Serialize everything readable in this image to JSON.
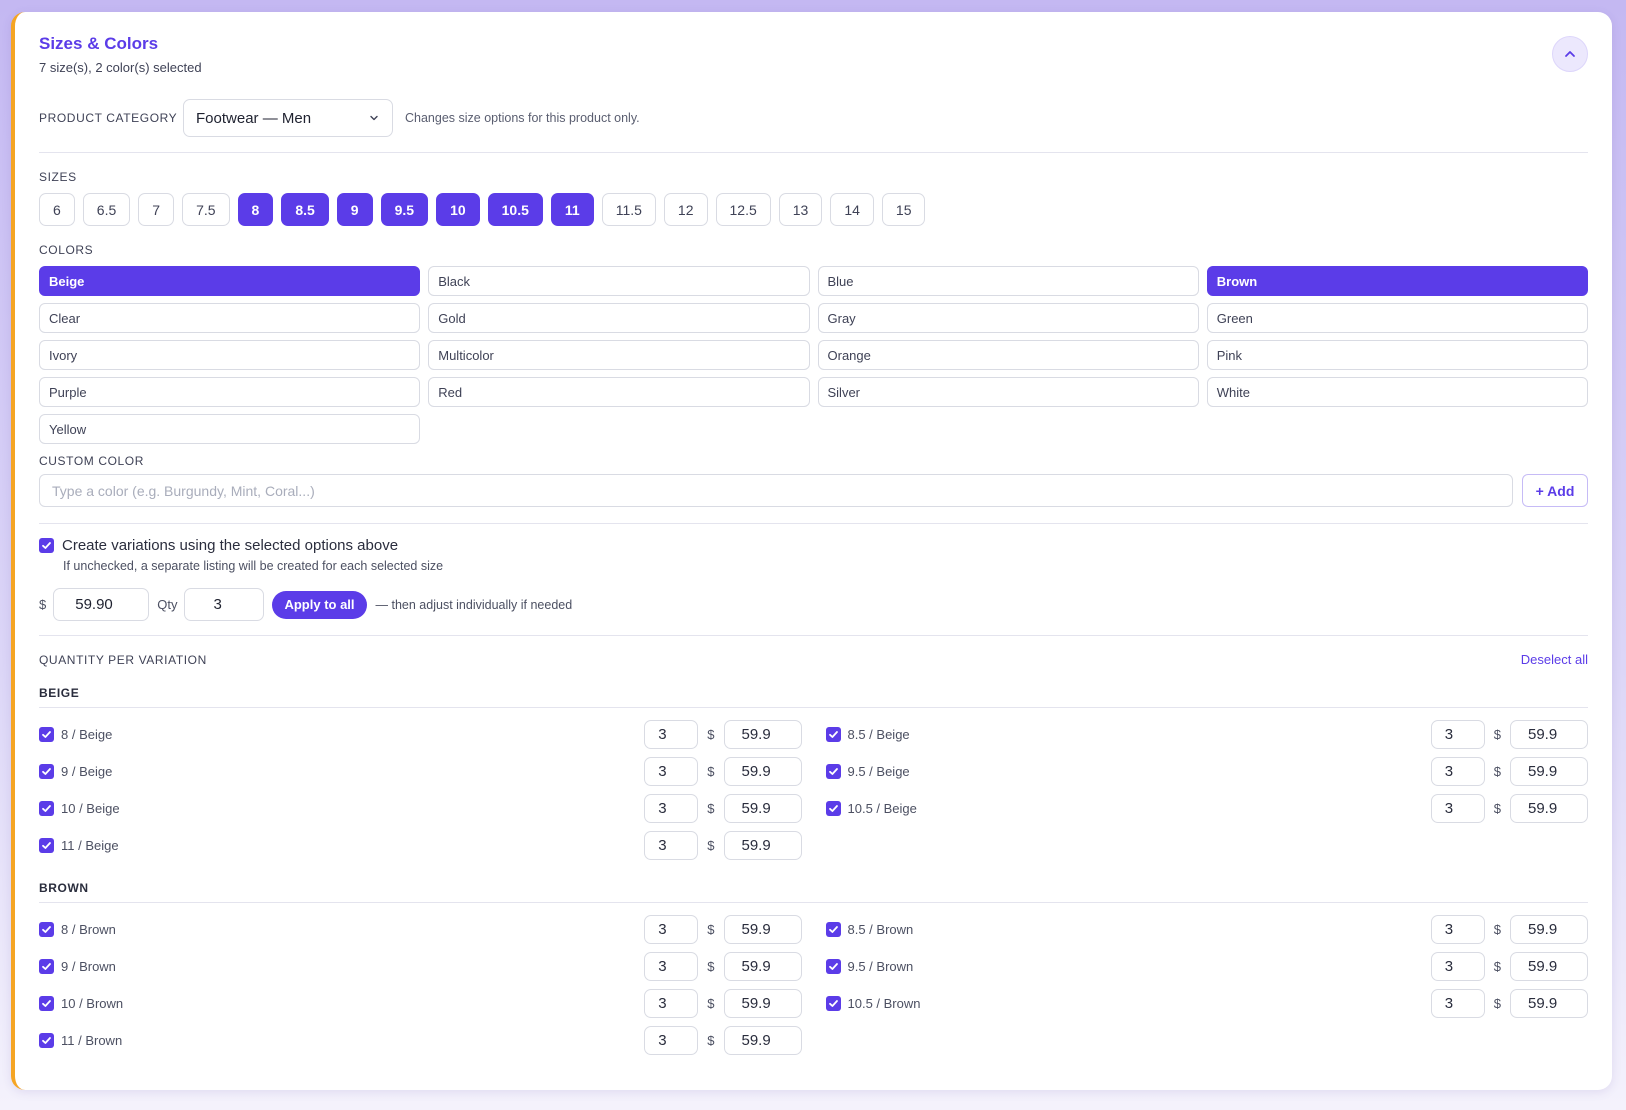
{
  "section": {
    "title": "Sizes & Colors",
    "subtitle": "7 size(s), 2 color(s) selected"
  },
  "category": {
    "label": "PRODUCT CATEGORY",
    "value": "Footwear — Men",
    "hint": "Changes size options for this product only."
  },
  "sizes": {
    "label": "SIZES",
    "options": [
      {
        "label": "6",
        "selected": false
      },
      {
        "label": "6.5",
        "selected": false
      },
      {
        "label": "7",
        "selected": false
      },
      {
        "label": "7.5",
        "selected": false
      },
      {
        "label": "8",
        "selected": true
      },
      {
        "label": "8.5",
        "selected": true
      },
      {
        "label": "9",
        "selected": true
      },
      {
        "label": "9.5",
        "selected": true
      },
      {
        "label": "10",
        "selected": true
      },
      {
        "label": "10.5",
        "selected": true
      },
      {
        "label": "11",
        "selected": true
      },
      {
        "label": "11.5",
        "selected": false
      },
      {
        "label": "12",
        "selected": false
      },
      {
        "label": "12.5",
        "selected": false
      },
      {
        "label": "13",
        "selected": false
      },
      {
        "label": "14",
        "selected": false
      },
      {
        "label": "15",
        "selected": false
      }
    ]
  },
  "colors": {
    "label": "COLORS",
    "options": [
      {
        "label": "Beige",
        "selected": true
      },
      {
        "label": "Black",
        "selected": false
      },
      {
        "label": "Blue",
        "selected": false
      },
      {
        "label": "Brown",
        "selected": true
      },
      {
        "label": "Clear",
        "selected": false
      },
      {
        "label": "Gold",
        "selected": false
      },
      {
        "label": "Gray",
        "selected": false
      },
      {
        "label": "Green",
        "selected": false
      },
      {
        "label": "Ivory",
        "selected": false
      },
      {
        "label": "Multicolor",
        "selected": false
      },
      {
        "label": "Orange",
        "selected": false
      },
      {
        "label": "Pink",
        "selected": false
      },
      {
        "label": "Purple",
        "selected": false
      },
      {
        "label": "Red",
        "selected": false
      },
      {
        "label": "Silver",
        "selected": false
      },
      {
        "label": "White",
        "selected": false
      },
      {
        "label": "Yellow",
        "selected": false
      }
    ]
  },
  "custom_color": {
    "label": "CUSTOM COLOR",
    "placeholder": "Type a color (e.g. Burgundy, Mint, Coral...)",
    "add_label": "+ Add"
  },
  "variations": {
    "checked": true,
    "label": "Create variations using the selected options above",
    "note": "If unchecked, a separate listing will be created for each selected size"
  },
  "bulk": {
    "currency": "$",
    "price": "59.90",
    "qty_label": "Qty",
    "qty": "3",
    "apply_label": "Apply to all",
    "hint": "— then adjust individually if needed"
  },
  "quantity_per_variation": {
    "label": "QUANTITY PER VARIATION",
    "deselect_label": "Deselect all",
    "currency": "$",
    "groups": [
      {
        "title": "BEIGE",
        "rows": [
          {
            "name": "8 / Beige",
            "qty": "3",
            "price": "59.9",
            "checked": true
          },
          {
            "name": "8.5 / Beige",
            "qty": "3",
            "price": "59.9",
            "checked": true
          },
          {
            "name": "9 / Beige",
            "qty": "3",
            "price": "59.9",
            "checked": true
          },
          {
            "name": "9.5 / Beige",
            "qty": "3",
            "price": "59.9",
            "checked": true
          },
          {
            "name": "10 / Beige",
            "qty": "3",
            "price": "59.9",
            "checked": true
          },
          {
            "name": "10.5 / Beige",
            "qty": "3",
            "price": "59.9",
            "checked": true
          },
          {
            "name": "11 / Beige",
            "qty": "3",
            "price": "59.9",
            "checked": true
          }
        ]
      },
      {
        "title": "BROWN",
        "rows": [
          {
            "name": "8 / Brown",
            "qty": "3",
            "price": "59.9",
            "checked": true
          },
          {
            "name": "8.5 / Brown",
            "qty": "3",
            "price": "59.9",
            "checked": true
          },
          {
            "name": "9 / Brown",
            "qty": "3",
            "price": "59.9",
            "checked": true
          },
          {
            "name": "9.5 / Brown",
            "qty": "3",
            "price": "59.9",
            "checked": true
          },
          {
            "name": "10 / Brown",
            "qty": "3",
            "price": "59.9",
            "checked": true
          },
          {
            "name": "10.5 / Brown",
            "qty": "3",
            "price": "59.9",
            "checked": true
          },
          {
            "name": "11 / Brown",
            "qty": "3",
            "price": "59.9",
            "checked": true
          }
        ]
      }
    ]
  },
  "icons": {
    "collapse": "chevron-up-icon",
    "dropdown": "chevron-down-icon",
    "checkbox": "checkmark-icon"
  },
  "theme": {
    "accent": "#5b3ce8",
    "card_stripe": "#f5a524"
  }
}
